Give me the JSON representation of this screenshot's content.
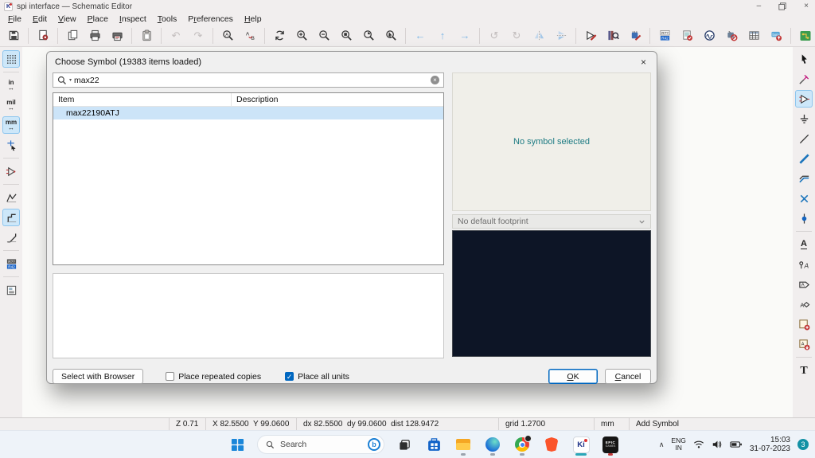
{
  "window": {
    "title": "spi interface — Schematic Editor",
    "controls": {
      "minimize": "–",
      "close": "×"
    }
  },
  "menu": {
    "items": [
      {
        "pre": "",
        "accel": "F",
        "post": "ile"
      },
      {
        "pre": "",
        "accel": "E",
        "post": "dit"
      },
      {
        "pre": "",
        "accel": "V",
        "post": "iew"
      },
      {
        "pre": "",
        "accel": "P",
        "post": "lace"
      },
      {
        "pre": "",
        "accel": "I",
        "post": "nspect"
      },
      {
        "pre": "",
        "accel": "T",
        "post": "ools"
      },
      {
        "pre": "P",
        "accel": "r",
        "post": "eferences"
      },
      {
        "pre": "",
        "accel": "H",
        "post": "elp"
      }
    ]
  },
  "toolbar": {
    "icons": [
      "save",
      "schematic-setup",
      "new-sheet",
      "print",
      "plot",
      "paste",
      "undo",
      "redo",
      "find",
      "find-replace",
      "refresh-view",
      "zoom-in",
      "zoom-out",
      "zoom-fit",
      "zoom-objects",
      "zoom-selection",
      "nav-back",
      "nav-up",
      "nav-forward",
      "rotate-ccw",
      "rotate-cw",
      "mirror-horizontal",
      "mirror-vertical",
      "symbol-editor",
      "symbol-library-browser",
      "footprint-editor",
      "annotate",
      "erc",
      "simulator",
      "probe",
      "symbol-fields-table",
      "bom",
      "pcb-editor",
      "scripting-console"
    ]
  },
  "sidebar_left": {
    "units": [
      "in",
      "mil",
      "mm"
    ],
    "icons": [
      "grid-dots",
      "unit-inches",
      "unit-mils",
      "unit-mm",
      "snap-cursor",
      "crossprobe",
      "sketch-free-angle",
      "sketch-90-degree",
      "sketch-45-degree",
      "annotate-auto",
      "hierarchy-navigator"
    ]
  },
  "sidebar_right": {
    "icons": [
      "select-arrow",
      "highlight-net",
      "place-symbol",
      "place-power-port",
      "draw-wire",
      "draw-bus",
      "wire-to-bus-entry",
      "no-connect",
      "junction",
      "net-label",
      "netclass-directive",
      "global-label",
      "hierarchical-label",
      "hierarchical-sheet",
      "sheet-pin",
      "text"
    ],
    "glyphs": {
      "label": "A",
      "text": "T"
    }
  },
  "dialog": {
    "title": "Choose Symbol (19383 items loaded)",
    "close": "×",
    "search": {
      "value": "max22"
    },
    "table": {
      "headers": [
        "Item",
        "Description"
      ],
      "rows": [
        {
          "item": "max22190ATJ",
          "description": "",
          "selected": true
        }
      ]
    },
    "symbol_preview": {
      "message": "No symbol selected"
    },
    "footprint_select": {
      "value": "No default footprint"
    },
    "checkboxes": [
      {
        "label": "Place repeated copies",
        "checked": false,
        "checkmark": ""
      },
      {
        "label": "Place all units",
        "checked": true,
        "checkmark": "✓"
      }
    ],
    "buttons": {
      "select_with_browser": "Select with Browser",
      "ok": {
        "accel": "O",
        "post": "K"
      },
      "cancel": {
        "accel": "C",
        "post": "ancel"
      }
    }
  },
  "statusbar": {
    "zoom": "Z 0.71",
    "position": "X 82.5500  Y 99.0600",
    "delta": "dx 82.5500  dy 99.0600  dist 128.9472",
    "grid": "grid 1.2700",
    "units": "mm",
    "mode": "Add Symbol"
  },
  "taskbar": {
    "search_label": "Search",
    "apps": [
      "start",
      "search",
      "task-view",
      "microsoft-store",
      "file-explorer",
      "edge",
      "chrome",
      "brave",
      "kicad",
      "epic-games"
    ],
    "tray": {
      "language": "ENG",
      "region": "IN",
      "time": "15:03",
      "date": "31-07-2023",
      "notification_count": "3"
    }
  },
  "colors": {
    "selection_blue": "#cce4f8",
    "message_teal": "#1d7b83",
    "footprint_preview_bg": "#0d1526",
    "checkbox_checked": "#0067c0",
    "active_tool_bg": "#cde7f9",
    "taskbar_active_underline": "#2aa7b8"
  }
}
